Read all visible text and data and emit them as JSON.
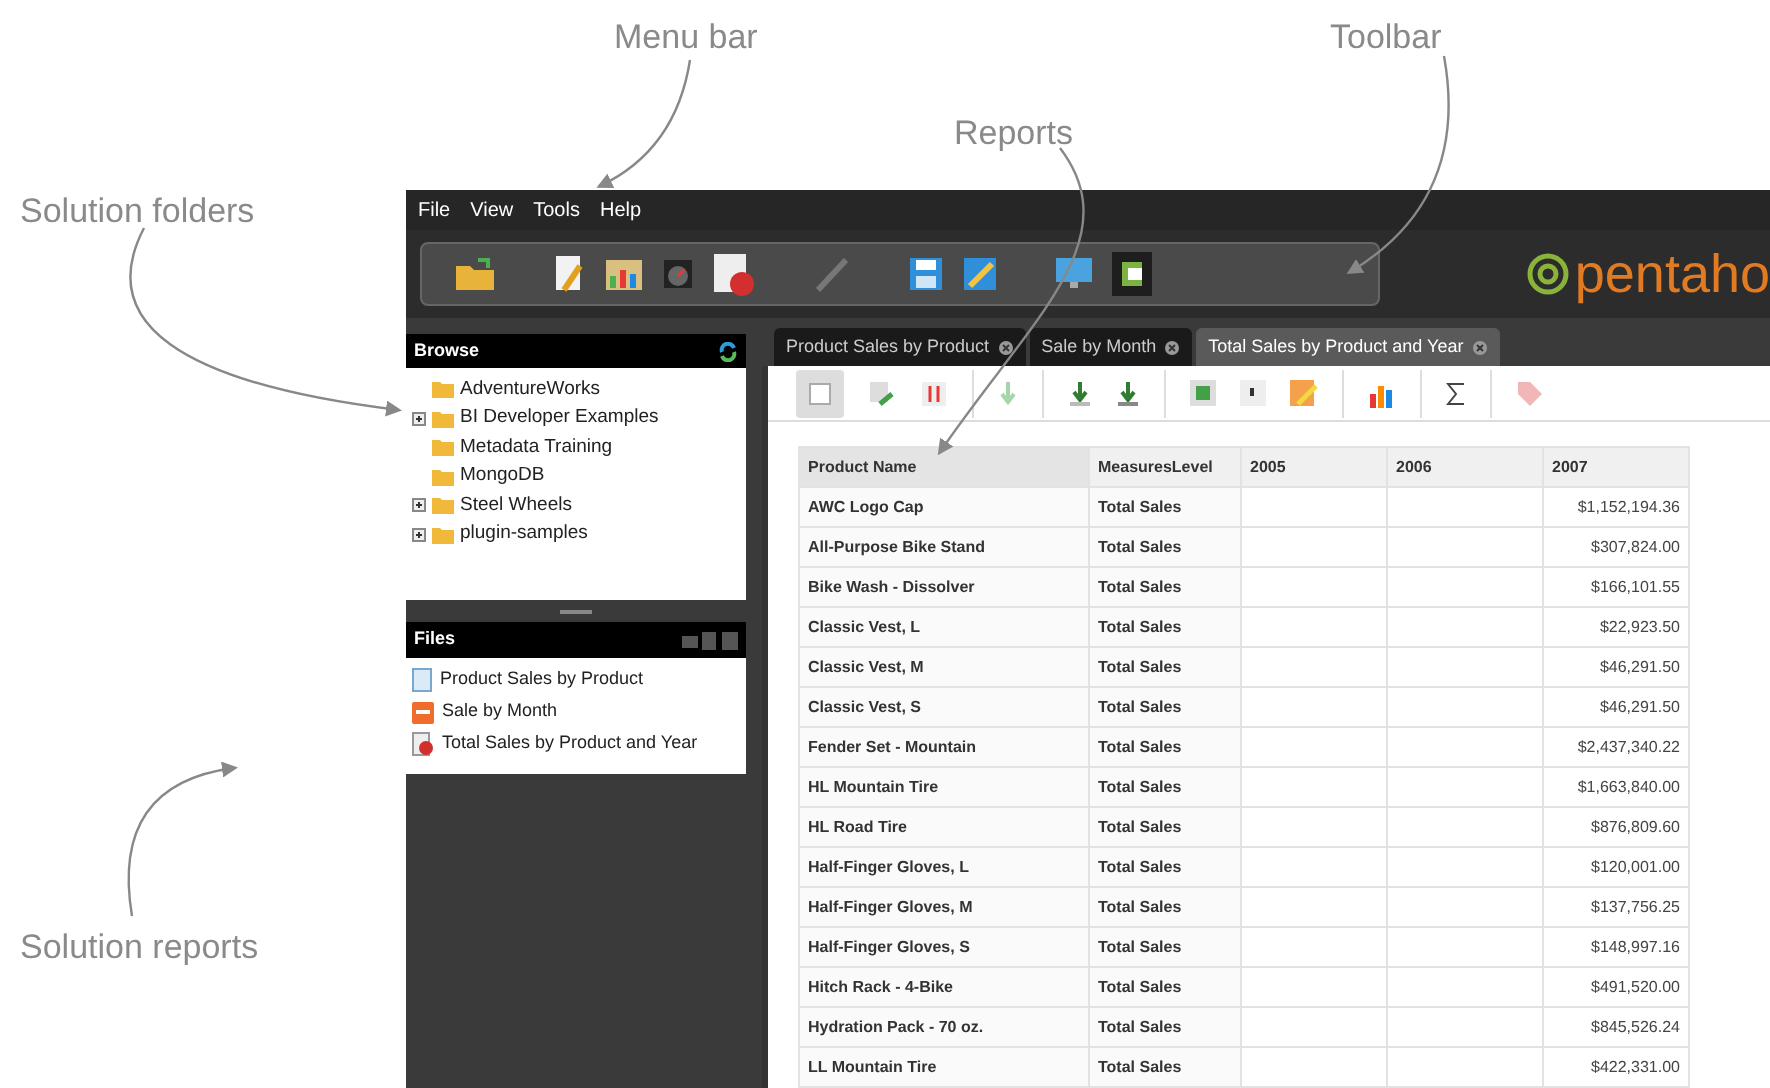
{
  "callouts": [
    {
      "label": "Menu bar"
    },
    {
      "label": "Reports"
    },
    {
      "label": "Toolbar"
    },
    {
      "label": "Solution folders"
    },
    {
      "label": "Solution reports"
    }
  ],
  "menu": [
    "File",
    "View",
    "Tools",
    "Help"
  ],
  "logo": "pentaho",
  "browse": {
    "title": "Browse",
    "folders": [
      {
        "label": "AdventureWorks",
        "expandable": false
      },
      {
        "label": "BI Developer Examples",
        "expandable": true
      },
      {
        "label": "Metadata Training",
        "expandable": false
      },
      {
        "label": "MongoDB",
        "expandable": false
      },
      {
        "label": "Steel Wheels",
        "expandable": true
      },
      {
        "label": "plugin-samples",
        "expandable": true
      }
    ]
  },
  "files": {
    "title": "Files",
    "items": [
      {
        "label": "Product Sales by Product",
        "kind": "report"
      },
      {
        "label": "Sale by Month",
        "kind": "pdf"
      },
      {
        "label": "Total Sales by Product and Year",
        "kind": "analysis"
      }
    ]
  },
  "tabs": [
    {
      "label": "Product Sales by Product",
      "selected": false
    },
    {
      "label": "Sale by Month",
      "selected": false
    },
    {
      "label": "Total Sales by Product and Year",
      "selected": true
    }
  ],
  "table": {
    "columns": [
      "Product Name",
      "MeasuresLevel",
      "2005",
      "2006",
      "2007"
    ],
    "rows": [
      [
        "AWC Logo Cap",
        "Total Sales",
        "",
        "",
        "$1,152,194.36"
      ],
      [
        "All-Purpose Bike Stand",
        "Total Sales",
        "",
        "",
        "$307,824.00"
      ],
      [
        "Bike Wash - Dissolver",
        "Total Sales",
        "",
        "",
        "$166,101.55"
      ],
      [
        "Classic Vest, L",
        "Total Sales",
        "",
        "",
        "$22,923.50"
      ],
      [
        "Classic Vest, M",
        "Total Sales",
        "",
        "",
        "$46,291.50"
      ],
      [
        "Classic Vest, S",
        "Total Sales",
        "",
        "",
        "$46,291.50"
      ],
      [
        "Fender Set - Mountain",
        "Total Sales",
        "",
        "",
        "$2,437,340.22"
      ],
      [
        "HL Mountain Tire",
        "Total Sales",
        "",
        "",
        "$1,663,840.00"
      ],
      [
        "HL Road Tire",
        "Total Sales",
        "",
        "",
        "$876,809.60"
      ],
      [
        "Half-Finger Gloves, L",
        "Total Sales",
        "",
        "",
        "$120,001.00"
      ],
      [
        "Half-Finger Gloves, M",
        "Total Sales",
        "",
        "",
        "$137,756.25"
      ],
      [
        "Half-Finger Gloves, S",
        "Total Sales",
        "",
        "",
        "$148,997.16"
      ],
      [
        "Hitch Rack - 4-Bike",
        "Total Sales",
        "",
        "",
        "$491,520.00"
      ],
      [
        "Hydration Pack - 70 oz.",
        "Total Sales",
        "",
        "",
        "$845,526.24"
      ],
      [
        "LL Mountain Tire",
        "Total Sales",
        "",
        "",
        "$422,331.00"
      ]
    ]
  }
}
